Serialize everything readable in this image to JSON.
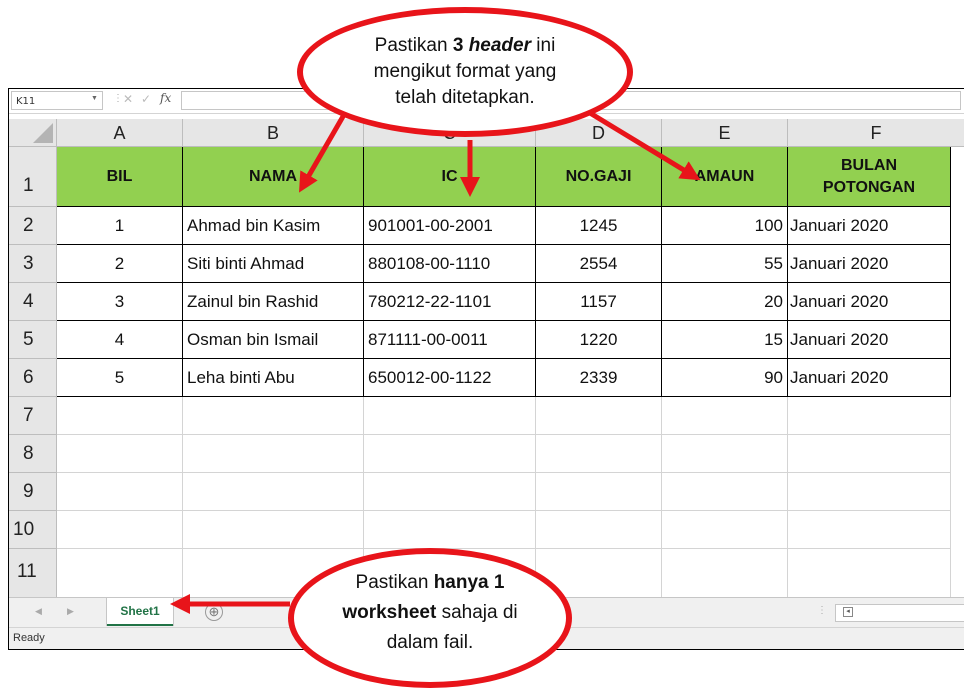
{
  "formula_bar": {
    "name_box": "K11",
    "fx_label": "fx"
  },
  "columns": [
    "A",
    "B",
    "C",
    "D",
    "E",
    "F"
  ],
  "rows": [
    "1",
    "2",
    "3",
    "4",
    "5",
    "6",
    "7",
    "8",
    "9",
    "10",
    "11"
  ],
  "table": {
    "headers": [
      "BIL",
      "NAMA",
      "IC",
      "NO.GAJI",
      "AMAUN"
    ],
    "header_f_line1": "BULAN",
    "header_f_line2": "POTONGAN",
    "header_color": "#92d050",
    "records": [
      {
        "bil": "1",
        "nama": "Ahmad bin Kasim",
        "ic": "901001-00-2001",
        "gaji": "1245",
        "amaun": "100",
        "bulan": "Januari 2020"
      },
      {
        "bil": "2",
        "nama": "Siti binti Ahmad",
        "ic": "880108-00-1110",
        "gaji": "2554",
        "amaun": "55",
        "bulan": "Januari 2020"
      },
      {
        "bil": "3",
        "nama": "Zainul bin Rashid",
        "ic": "780212-22-1101",
        "gaji": "1157",
        "amaun": "20",
        "bulan": "Januari 2020"
      },
      {
        "bil": "4",
        "nama": "Osman bin Ismail",
        "ic": "871111-00-0011",
        "gaji": "1220",
        "amaun": "15",
        "bulan": "Januari 2020"
      },
      {
        "bil": "5",
        "nama": "Leha binti Abu",
        "ic": "650012-00-1122",
        "gaji": "2339",
        "amaun": "90",
        "bulan": "Januari 2020"
      }
    ]
  },
  "sheet_tab": "Sheet1",
  "add_sheet_symbol": "⊕",
  "status": "Ready",
  "callout_top": {
    "pre": "Pastikan ",
    "b1": "3 ",
    "bi": "header",
    "post": "  ini",
    "line2": "mengikut format yang",
    "line3": "telah ditetapkan."
  },
  "callout_bottom": {
    "pre": "Pastikan ",
    "b1": "hanya 1",
    "b2": "worksheet",
    "post": " sahaja di",
    "line3": "dalam fail."
  },
  "accent_red": "#e8141a",
  "excel_green": "#217346"
}
